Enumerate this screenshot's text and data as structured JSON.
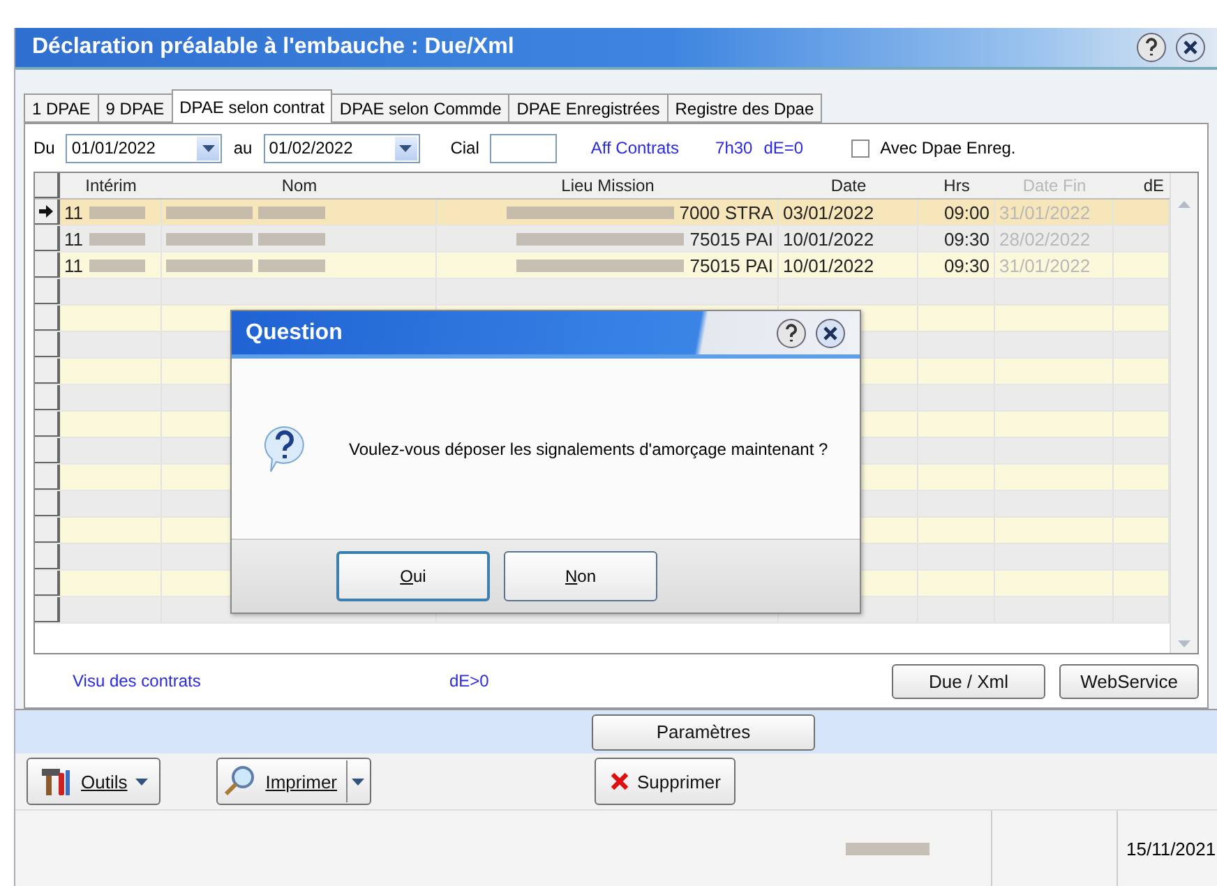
{
  "window": {
    "title": "Déclaration préalable à l'embauche : Due/Xml"
  },
  "tabs": [
    {
      "label": "1 DPAE",
      "selected": false
    },
    {
      "label": "9 DPAE",
      "selected": false
    },
    {
      "label": "DPAE selon contrat",
      "selected": true
    },
    {
      "label": "DPAE selon Commde",
      "selected": false
    },
    {
      "label": "DPAE Enregistrées",
      "selected": false
    },
    {
      "label": "Registre des Dpae",
      "selected": false
    }
  ],
  "filters": {
    "from_label": "Du",
    "from": "01/01/2022",
    "to_label": "au",
    "to": "01/02/2022",
    "cial_label": "Cial",
    "link": "Aff Contrats",
    "hours": "7h30",
    "de": "dE=0",
    "checkbox": {
      "label": "Avec Dpae Enreg.",
      "checked": false
    }
  },
  "table": {
    "columns": [
      "Intérim",
      "Nom",
      "Lieu Mission",
      "Date",
      "Hrs",
      "Date Fin",
      "dE"
    ],
    "rows": [
      {
        "interim": "11",
        "lieu": "7000 STRA",
        "date": "03/01/2022",
        "hrs": "09:00",
        "date_fin": "31/01/2022",
        "selected": true
      },
      {
        "interim": "11",
        "lieu": "75015 PAI",
        "date": "10/01/2022",
        "hrs": "09:30",
        "date_fin": "28/02/2022",
        "selected": false
      },
      {
        "interim": "11",
        "lieu": "75015 PAI",
        "date": "10/01/2022",
        "hrs": "09:30",
        "date_fin": "31/01/2022",
        "selected": false
      }
    ]
  },
  "footer": {
    "links": [
      "Visu des contrats",
      "dE>0"
    ],
    "buttons": [
      "Due / Xml",
      "WebService"
    ]
  },
  "settings_button": "Paramètres",
  "toolbar": [
    {
      "kind": "dropdown",
      "label": "Outils"
    },
    {
      "kind": "split",
      "label": "Imprimer"
    },
    {
      "kind": "plain",
      "label": "Supprimer"
    }
  ],
  "status_bar": {
    "date": "15/11/2021"
  },
  "dialog": {
    "title": "Question",
    "message": "Voulez-vous déposer les signalements d'amorçage maintenant ?",
    "buttons": [
      {
        "label": "Oui",
        "selected": true
      },
      {
        "label": "Non",
        "selected": false
      }
    ]
  }
}
